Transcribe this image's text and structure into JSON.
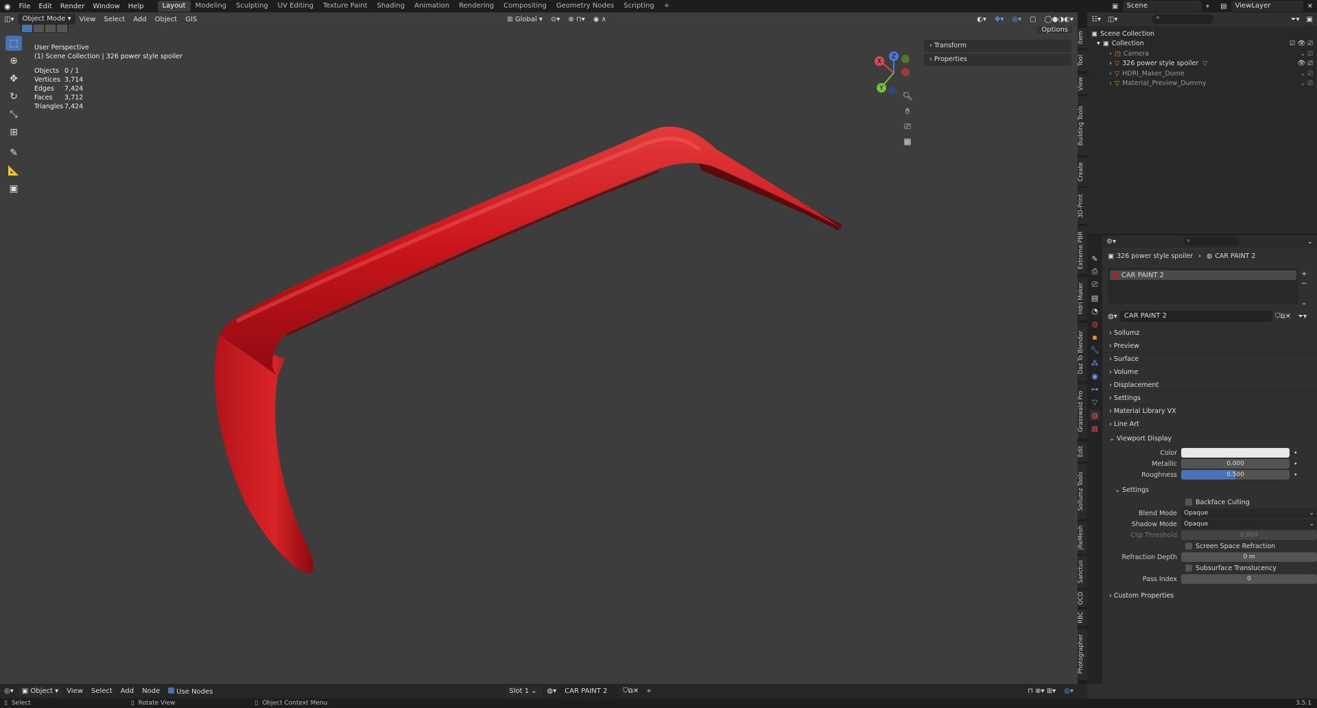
{
  "menu": [
    "File",
    "Edit",
    "Render",
    "Window",
    "Help"
  ],
  "workspaces": [
    "Layout",
    "Modeling",
    "Sculpting",
    "UV Editing",
    "Texture Paint",
    "Shading",
    "Animation",
    "Rendering",
    "Compositing",
    "Geometry Nodes",
    "Scripting"
  ],
  "active_workspace": "Layout",
  "add_tab": "+",
  "scene": {
    "name": "Scene",
    "view_layer": "ViewLayer"
  },
  "viewport_header": {
    "mode": "Object Mode",
    "menus": [
      "View",
      "Select",
      "Add",
      "Object",
      "GIS"
    ],
    "orientation": "Global",
    "options": "Options"
  },
  "overlay": {
    "title": "User Perspective",
    "subtitle": "(1) Scene Collection | 326 power style spoiler",
    "stats": [
      {
        "k": "Objects",
        "v": "0 / 1"
      },
      {
        "k": "Vertices",
        "v": "3,714"
      },
      {
        "k": "Edges",
        "v": "7,424"
      },
      {
        "k": "Faces",
        "v": "3,712"
      },
      {
        "k": "Triangles",
        "v": "7,424"
      }
    ]
  },
  "gizmo": {
    "x": "X",
    "y": "Y",
    "z": "Z"
  },
  "npanel": [
    "Transform",
    "Properties"
  ],
  "sidebar_tabs": [
    "Item",
    "Tool",
    "View",
    "Building Tools",
    "Create",
    "3D-Print",
    "Extreme PBR",
    "Hdri Maker",
    "Daz To Blender",
    "Grasswald Pro",
    "Edit",
    "Sollumz Tools",
    "jReMesh",
    "Sanctus",
    "OCD",
    "RBC",
    "Photographer"
  ],
  "outliner": {
    "root": "Scene Collection",
    "collection": "Collection",
    "items": [
      "Camera",
      "326 power style spoiler",
      "HDRI_Maker_Dome",
      "Material_Preview_Dummy"
    ]
  },
  "properties": {
    "breadcrumb_object": "326 power style spoiler",
    "breadcrumb_material": "CAR PAINT 2",
    "slot": "CAR PAINT 2",
    "material": "CAR PAINT 2",
    "sections": [
      "Sollumz",
      "Preview",
      "Surface",
      "Volume",
      "Displacement",
      "Settings",
      "Material Library VX",
      "Line Art"
    ],
    "viewport_display": "Viewport Display",
    "color_label": "Color",
    "metallic_label": "Metallic",
    "metallic": "0.000",
    "roughness_label": "Roughness",
    "roughness": "0.500",
    "roughness_fill": 0.5,
    "settings": "Settings",
    "backface": "Backface Culling",
    "blend_label": "Blend Mode",
    "blend": "Opaque",
    "shadow_label": "Shadow Mode",
    "shadow": "Opaque",
    "clip_label": "Clip Threshold",
    "clip": "0.000",
    "ssr": "Screen Space Refraction",
    "refr_label": "Refraction Depth",
    "refr": "0 m",
    "sst": "Subsurface Translucency",
    "pass_label": "Pass Index",
    "pass": "0",
    "custom": "Custom Properties"
  },
  "bottom_header": {
    "mode": "Object",
    "menus": [
      "View",
      "Select",
      "Add",
      "Node"
    ],
    "use_nodes": "Use Nodes",
    "slot": "Slot 1",
    "material": "CAR PAINT 2"
  },
  "status": {
    "select": "Select",
    "rotate": "Rotate View",
    "context": "Object Context Menu",
    "version": "3.5.1"
  },
  "colors": {
    "accent": "#4772b3",
    "object": "#c8141b",
    "viewport": "#3d3d3d"
  }
}
